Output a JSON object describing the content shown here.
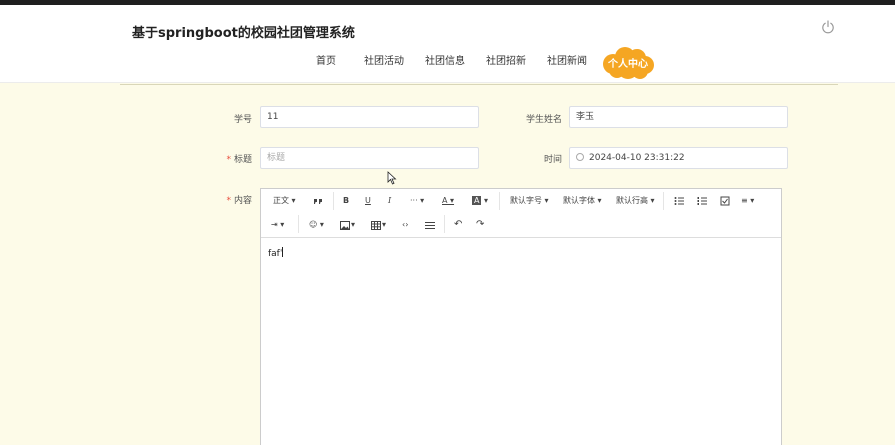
{
  "header": {
    "site_title": "基于springboot的校园社团管理系统",
    "power_icon": "power-icon"
  },
  "nav": {
    "items": [
      "首页",
      "社团活动",
      "社团信息",
      "社团招新",
      "社团新闻"
    ],
    "personal_center": "个人中心",
    "personal_center_color": "#f5a623"
  },
  "form": {
    "student_id_label": "学号",
    "student_id_value": "11",
    "student_name_label": "学生姓名",
    "student_name_value": "李玉",
    "title_label": "标题",
    "title_placeholder": "标题",
    "time_label": "时间",
    "time_value": "2024-04-10 23:31:22",
    "content_label": "内容",
    "required_mark": "*"
  },
  "editor": {
    "row1": {
      "paragraph": "正文",
      "font_size": "默认字号",
      "font_family": "默认字体",
      "line_height": "默认行高"
    },
    "content": "fafˈ"
  },
  "colors": {
    "background": "#fdfbe8",
    "accent": "#f5a623"
  }
}
